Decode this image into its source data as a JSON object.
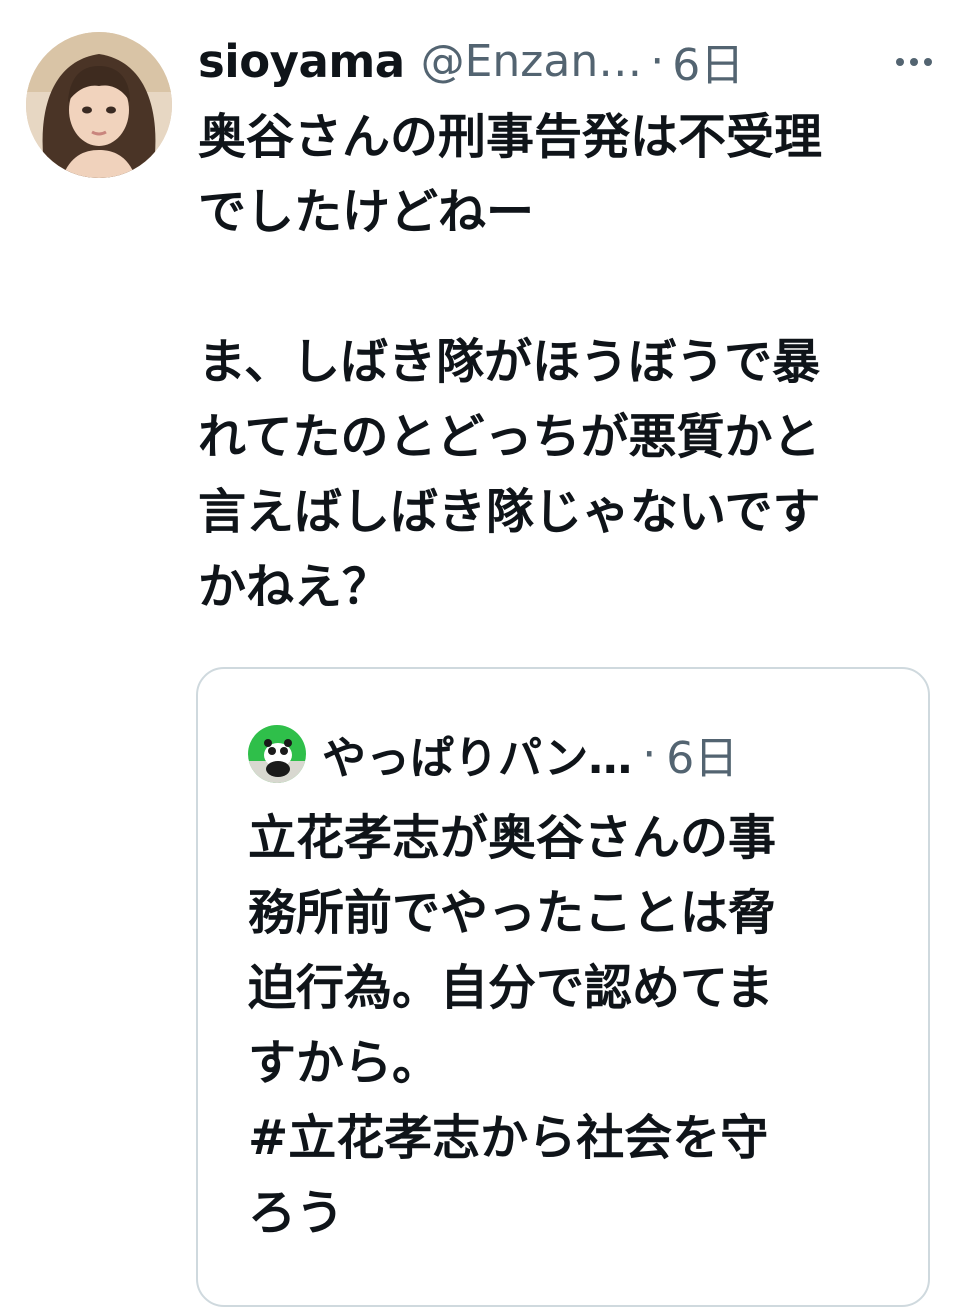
{
  "tweet": {
    "display_name": "sioyama",
    "handle": "@Enzan…",
    "separator": "·",
    "time": "6日",
    "more_icon": "more-horizontal-icon",
    "body": "奥谷さんの刑事告発は不受理\nでしたけどねー\n\nま、しばき隊がほうぼうで暴\nれてたのとどっちが悪質かと\n言えばしばき隊じゃないです\nかねえ？"
  },
  "quoted_tweet": {
    "display_name": "やっぱりパン…",
    "separator": "·",
    "time": "6日",
    "body": "立花孝志が奥谷さんの事\n務所前でやったことは脅\n迫行為。自分で認めてま\nすから。\n#立花孝志から社会を守\nろう"
  },
  "colors": {
    "text_primary": "#0f1419",
    "text_secondary": "#536471",
    "border": "#cfd9de"
  }
}
